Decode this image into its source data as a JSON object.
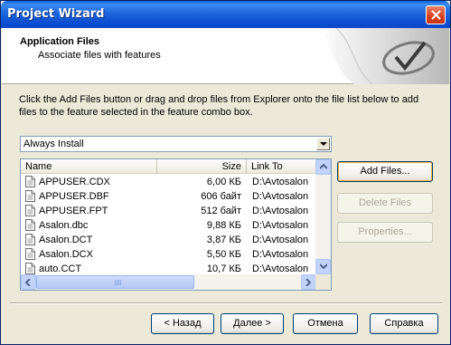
{
  "window": {
    "title": "Project Wizard"
  },
  "header": {
    "title": "Application Files",
    "subtitle": "Associate files with features"
  },
  "instructions": "Click the Add Files button or drag and drop files from Explorer onto the file list below to add files to the feature selected in the feature combo box.",
  "feature_combo": {
    "value": "Always Install"
  },
  "file_list": {
    "columns": {
      "name": "Name",
      "size": "Size",
      "link": "Link To"
    },
    "rows": [
      {
        "name": "APPUSER.CDX",
        "size": "6,00 КБ",
        "link": "D:\\Avtosalon"
      },
      {
        "name": "APPUSER.DBF",
        "size": "606 байт",
        "link": "D:\\Avtosalon"
      },
      {
        "name": "APPUSER.FPT",
        "size": "512 байт",
        "link": "D:\\Avtosalon"
      },
      {
        "name": "Asalon.dbc",
        "size": "9,88 КБ",
        "link": "D:\\Avtosalon"
      },
      {
        "name": "Asalon.DCT",
        "size": "3,87 КБ",
        "link": "D:\\Avtosalon"
      },
      {
        "name": "Asalon.DCX",
        "size": "5,50 КБ",
        "link": "D:\\Avtosalon"
      },
      {
        "name": "auto.CCT",
        "size": "10,7 КБ",
        "link": "D:\\Avtosalon"
      }
    ]
  },
  "side_buttons": {
    "add_files": "Add Files...",
    "delete_files": "Delete Files",
    "properties": "Properties..."
  },
  "footer": {
    "back": "< Назад",
    "next": "Далее >",
    "cancel": "Отмена",
    "help": "Справка"
  }
}
